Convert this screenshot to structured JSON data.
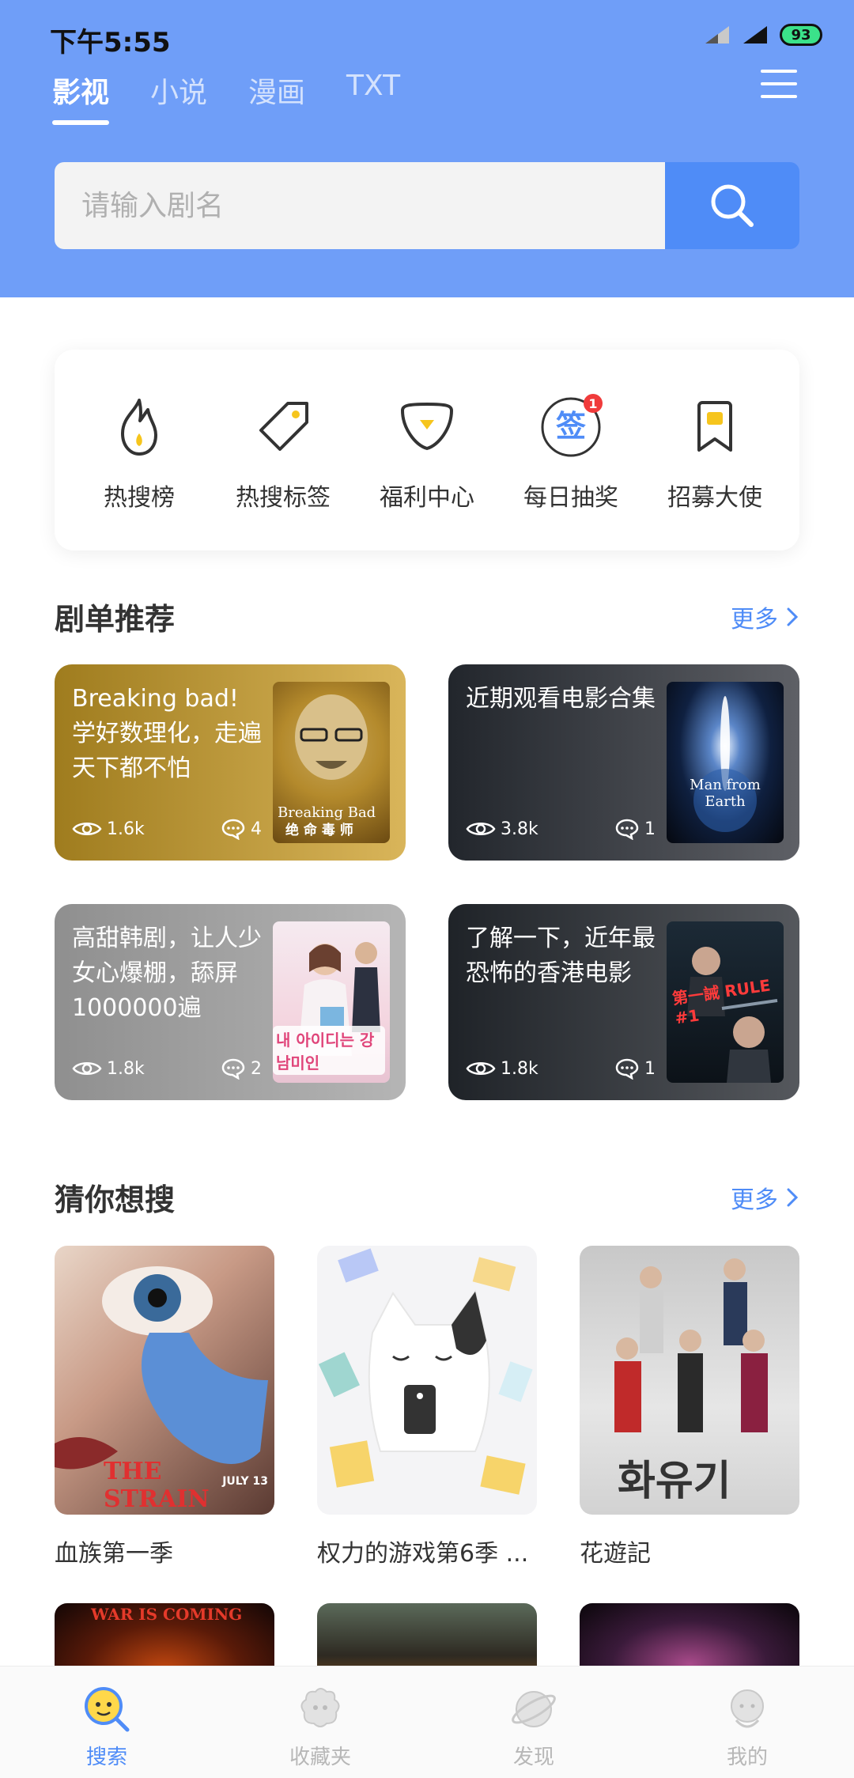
{
  "status": {
    "time": "下午5:55",
    "battery": "93"
  },
  "tabs": [
    {
      "label": "影视",
      "active": true
    },
    {
      "label": "小说",
      "active": false
    },
    {
      "label": "漫画",
      "active": false
    },
    {
      "label": "TXT",
      "active": false
    }
  ],
  "search": {
    "placeholder": "请输入剧名",
    "value": ""
  },
  "quick_actions": [
    {
      "label": "热搜榜",
      "icon": "flame-icon"
    },
    {
      "label": "热搜标签",
      "icon": "tag-icon"
    },
    {
      "label": "福利中心",
      "icon": "gift-badge-icon"
    },
    {
      "label": "每日抽奖",
      "icon": "sign-in-icon",
      "icon_text": "签",
      "badge": "1"
    },
    {
      "label": "招募大使",
      "icon": "bookmark-icon"
    }
  ],
  "playlists_section": {
    "title": "剧单推荐",
    "more": "更多",
    "items": [
      {
        "title": "Breaking bad! 学好数理化，走遍天下都不怕",
        "views": "1.6k",
        "comments": "4",
        "poster_text": "Breaking Bad",
        "poster_sub": "绝 命 毒 师"
      },
      {
        "title": "近期观看电影合集",
        "views": "3.8k",
        "comments": "1",
        "poster_text": "Man from Earth"
      },
      {
        "title": "高甜韩剧，让人少女心爆棚，舔屏1000000遍",
        "views": "1.8k",
        "comments": "2",
        "poster_text": "내 아이디는 강남미인"
      },
      {
        "title": "了解一下，近年最恐怖的香港电影",
        "views": "1.8k",
        "comments": "1",
        "poster_text": "第一誡 RULE #1"
      }
    ]
  },
  "guess_section": {
    "title": "猜你想搜",
    "more": "更多",
    "items": [
      {
        "title": "血族第一季",
        "poster_text": "THE STRAIN",
        "poster_date": "JULY 13"
      },
      {
        "title": "权力的游戏第6季 ...",
        "poster_text": ""
      },
      {
        "title": "花遊記",
        "poster_text": "화유기"
      }
    ],
    "row2": [
      {
        "poster_text": "WAR IS COMING"
      },
      {
        "poster_text": ""
      },
      {
        "poster_text": ""
      }
    ]
  },
  "bottom_nav": [
    {
      "label": "搜索",
      "icon": "search-face-icon",
      "active": true
    },
    {
      "label": "收藏夹",
      "icon": "favorites-icon",
      "active": false
    },
    {
      "label": "发现",
      "icon": "discover-icon",
      "active": false
    },
    {
      "label": "我的",
      "icon": "profile-icon",
      "active": false
    }
  ],
  "colors": {
    "header": "#6f9ef8",
    "accent": "#4f8cf7",
    "badge": "#f03b3b",
    "icon_yellow": "#f6c51d"
  }
}
